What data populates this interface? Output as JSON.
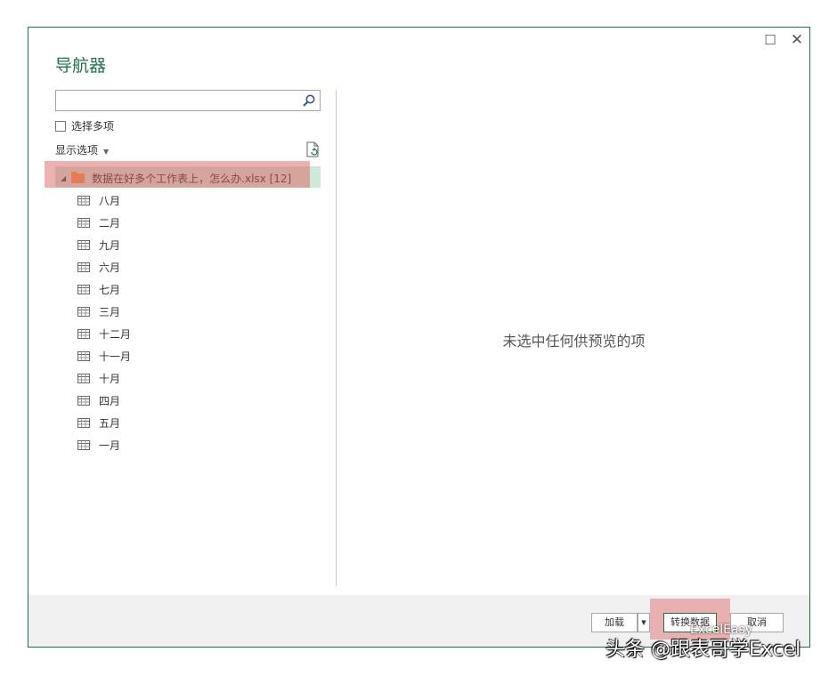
{
  "dialog": {
    "title": "导航器",
    "window_buttons": {
      "maximize": "☐",
      "close": "✕"
    }
  },
  "left_panel": {
    "search": {
      "placeholder": "",
      "value": ""
    },
    "select_multiple_label": "选择多项",
    "display_options_label": "显示选项",
    "tree": {
      "root": {
        "label": "数据在好多个工作表上，怎么办.xlsx [12]",
        "expanded": true
      },
      "items": [
        "八月",
        "二月",
        "九月",
        "六月",
        "七月",
        "三月",
        "十二月",
        "十一月",
        "十月",
        "四月",
        "五月",
        "一月"
      ]
    }
  },
  "preview": {
    "empty_message": "未选中任何供预览的项"
  },
  "footer": {
    "load_label": "加载",
    "transform_label": "转换数据",
    "cancel_label": "取消"
  },
  "watermark": {
    "text": "头条 @跟表哥学Excel",
    "small": "ExcelEasy"
  },
  "colors": {
    "accent": "#217346",
    "highlight": "#dc5050",
    "selection": "#cfe9d8"
  }
}
